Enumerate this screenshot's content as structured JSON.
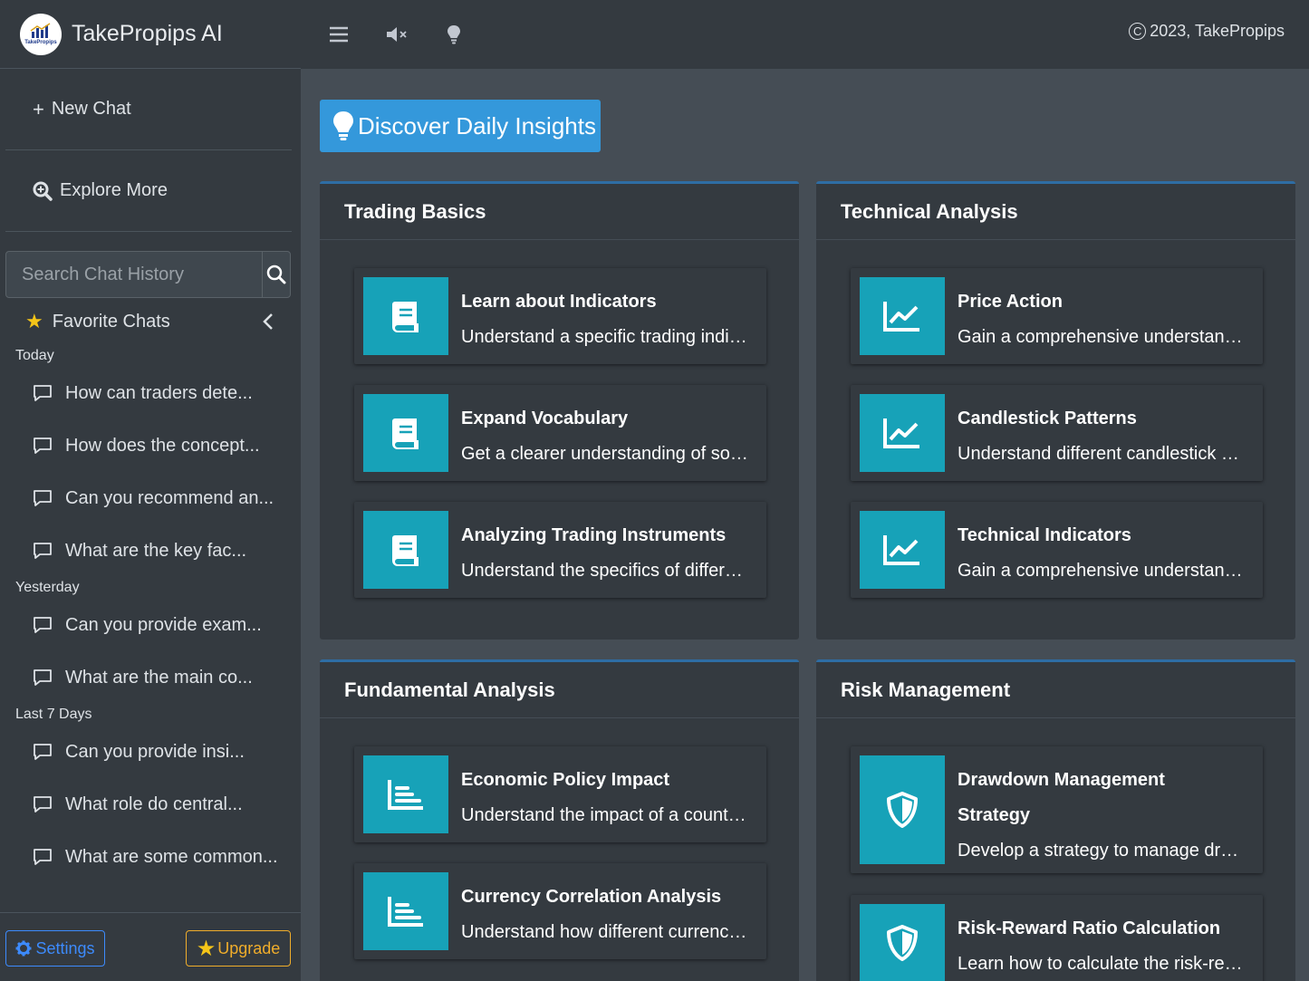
{
  "brand": {
    "name": "TakePropips AI",
    "logo_text": "TakePropips"
  },
  "sidebar": {
    "new_chat": "New Chat",
    "explore_more": "Explore More",
    "search_placeholder": "Search Chat History",
    "favorites": "Favorite Chats",
    "groups": [
      {
        "label": "Today",
        "items": [
          "How can traders dete...",
          "How does the concept...",
          "Can you recommend an...",
          "What are the key fac..."
        ]
      },
      {
        "label": "Yesterday",
        "items": [
          "Can you provide exam...",
          "What are the main co..."
        ]
      },
      {
        "label": "Last 7 Days",
        "items": [
          "Can you provide insi...",
          "What role do central...",
          "What are some common..."
        ]
      }
    ],
    "settings": "Settings",
    "upgrade": "Upgrade"
  },
  "topnav": {
    "copyright": "2023, TakePropips",
    "icons": [
      "menu-icon",
      "mute-icon",
      "lightbulb-icon"
    ]
  },
  "main": {
    "discover": "Discover Daily Insights",
    "cards": [
      {
        "title": "Trading Basics",
        "icon": "book-icon",
        "items": [
          {
            "title": "Learn about Indicators",
            "desc": "Understand a specific trading indicator"
          },
          {
            "title": "Expand Vocabulary",
            "desc": "Get a clearer understanding of some trading terms"
          },
          {
            "title": "Analyzing Trading Instruments",
            "desc": "Understand the specifics of different instruments"
          }
        ]
      },
      {
        "title": "Technical Analysis",
        "icon": "chart-line-icon",
        "items": [
          {
            "title": "Price Action",
            "desc": "Gain a comprehensive understanding of price action"
          },
          {
            "title": "Candlestick Patterns",
            "desc": "Understand different candlestick patterns"
          },
          {
            "title": "Technical Indicators",
            "desc": "Gain a comprehensive understanding of indicators"
          }
        ]
      },
      {
        "title": "Fundamental Analysis",
        "icon": "chart-bar-icon",
        "items": [
          {
            "title": "Economic Policy Impact",
            "desc": "Understand the impact of a country's policy"
          },
          {
            "title": "Currency Correlation Analysis",
            "desc": "Understand how different currencies correlate"
          }
        ]
      },
      {
        "title": "Risk Management",
        "icon": "shield-icon",
        "items": [
          {
            "title": "Drawdown Management Strategy",
            "desc": "Develop a strategy to manage drawdowns"
          },
          {
            "title": "Risk-Reward Ratio Calculation",
            "desc": "Learn how to calculate the risk-reward ratio"
          }
        ]
      }
    ]
  },
  "colors": {
    "accent": "#17a2b8",
    "discover": "#3498db",
    "sidebar": "#343a40",
    "upgrade": "#f0ad2b",
    "settings": "#3d8bfd"
  }
}
